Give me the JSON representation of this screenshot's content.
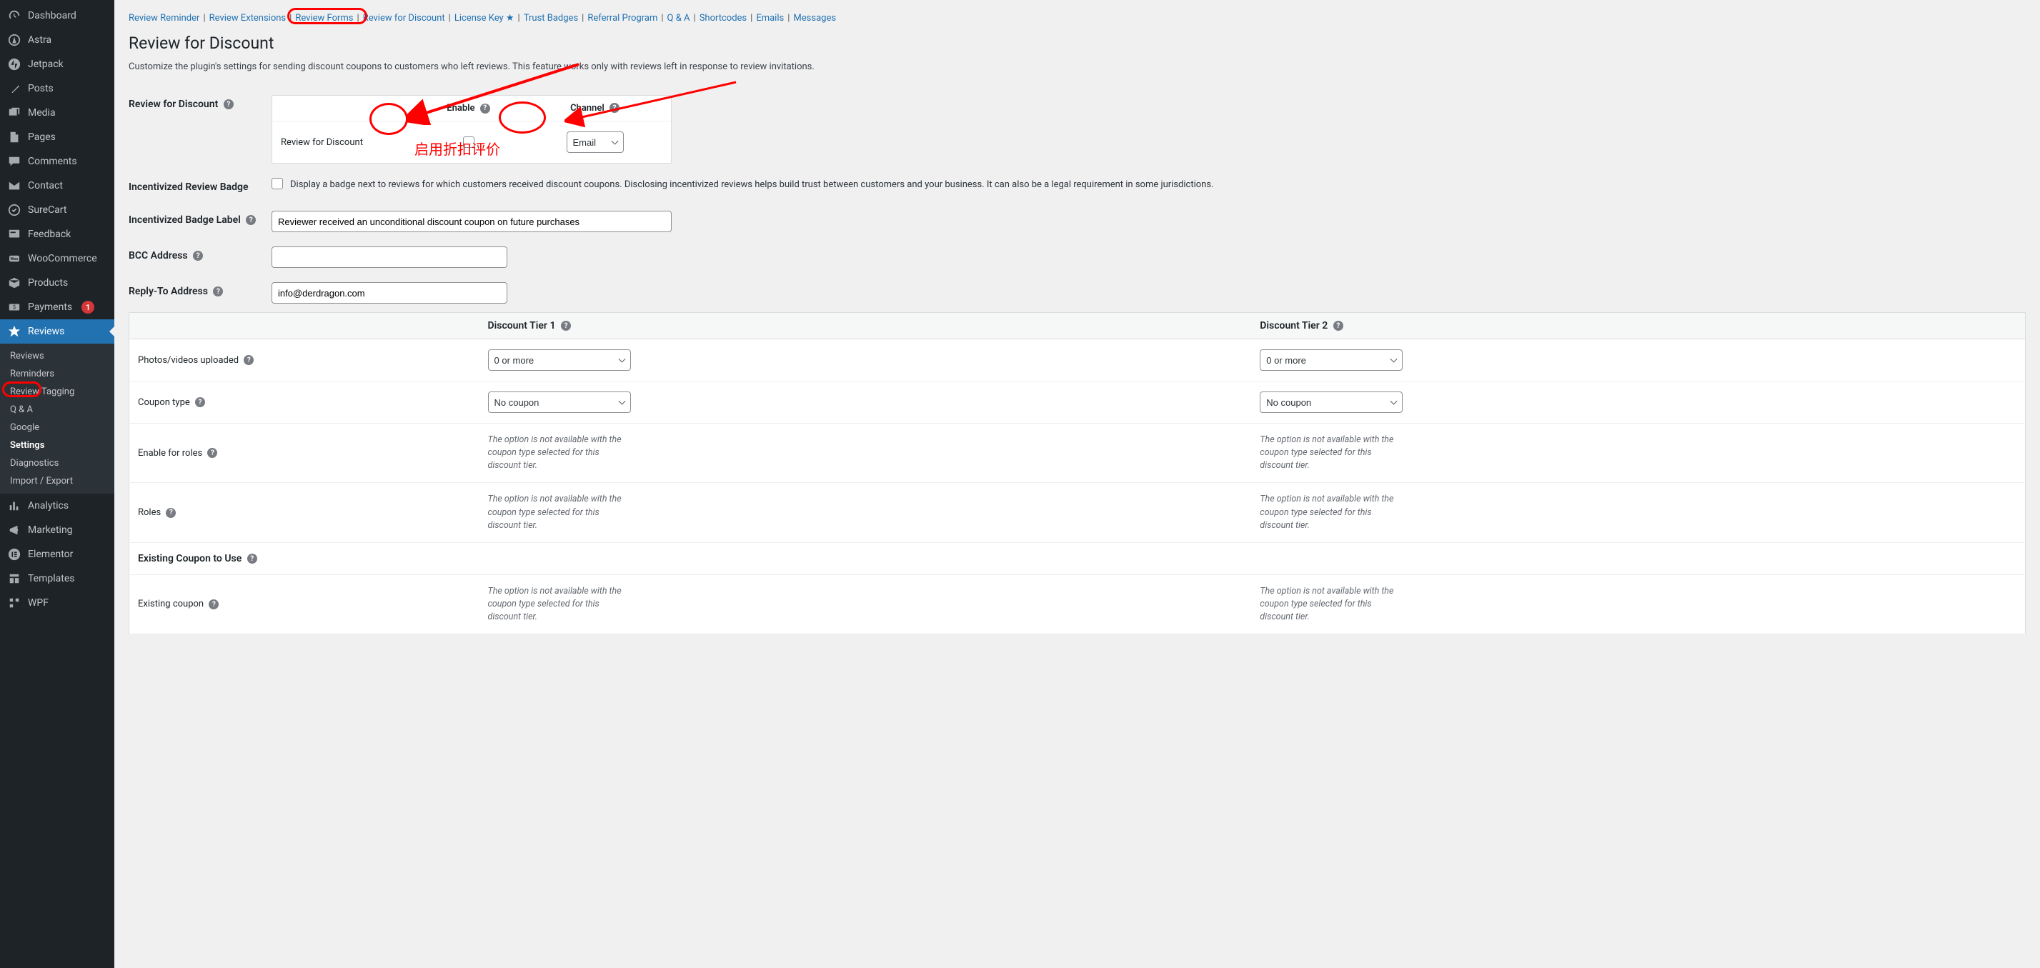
{
  "sidebar": {
    "items": [
      {
        "icon": "dashboard",
        "label": "Dashboard"
      },
      {
        "icon": "astra",
        "label": "Astra"
      },
      {
        "icon": "jetpack",
        "label": "Jetpack"
      },
      {
        "icon": "pin",
        "label": "Posts"
      },
      {
        "icon": "media",
        "label": "Media"
      },
      {
        "icon": "page",
        "label": "Pages"
      },
      {
        "icon": "comment",
        "label": "Comments"
      },
      {
        "icon": "envelope",
        "label": "Contact"
      },
      {
        "icon": "surecart",
        "label": "SureCart"
      },
      {
        "icon": "feedback",
        "label": "Feedback"
      },
      {
        "icon": "woo",
        "label": "WooCommerce"
      },
      {
        "icon": "box",
        "label": "Products"
      },
      {
        "icon": "payments",
        "label": "Payments",
        "badge": "1"
      },
      {
        "icon": "star",
        "label": "Reviews",
        "active": true
      }
    ],
    "submenu": [
      "Reviews",
      "Reminders",
      "Review Tagging",
      "Q & A",
      "Google",
      "Settings",
      "Diagnostics",
      "Import / Export"
    ],
    "submenu_selected": "Settings",
    "items_after": [
      {
        "icon": "analytics",
        "label": "Analytics"
      },
      {
        "icon": "marketing",
        "label": "Marketing"
      },
      {
        "icon": "elementor",
        "label": "Elementor"
      },
      {
        "icon": "templates",
        "label": "Templates"
      },
      {
        "icon": "wpe",
        "label": "WPF"
      }
    ]
  },
  "tabs": [
    "Review Reminder",
    "Review Extensions",
    "Review Forms",
    "Review for Discount",
    "License Key ★",
    "Trust Badges",
    "Referral Program",
    "Q & A",
    "Shortcodes",
    "Emails",
    "Messages"
  ],
  "page": {
    "title": "Review for Discount",
    "desc": "Customize the plugin's settings for sending discount coupons to customers who left reviews. This feature works only with reviews left in response to review invitations."
  },
  "fields": {
    "review_for_discount": {
      "th": "Review for Discount",
      "enable_hdr": "Enable",
      "channel_hdr": "Channel",
      "row_label": "Review for Discount",
      "channel_value": "Email"
    },
    "badge": {
      "th": "Incentivized Review Badge",
      "label": "Display a badge next to reviews for which customers received discount coupons. Disclosing incentivized reviews helps build trust between customers and your business. It can also be a legal requirement in some jurisdictions."
    },
    "badge_label": {
      "th": "Incentivized Badge Label",
      "value": "Reviewer received an unconditional discount coupon on future purchases"
    },
    "bcc": {
      "th": "BCC Address",
      "value": ""
    },
    "reply_to": {
      "th": "Reply-To Address",
      "value": "info@derdragon.com"
    }
  },
  "tiers": {
    "hdr1": "Discount Tier 1",
    "hdr2": "Discount Tier 2",
    "rows": [
      {
        "label": "Photos/videos uploaded",
        "v": "0 or more",
        "help": true,
        "type": "select"
      },
      {
        "label": "Coupon type",
        "v": "No coupon",
        "help": true,
        "type": "select"
      },
      {
        "label": "Enable for roles",
        "v": "__unavail",
        "help": true,
        "type": "text"
      },
      {
        "label": "Roles",
        "v": "__unavail",
        "help": true,
        "type": "text"
      }
    ],
    "section": "Existing Coupon to Use",
    "rows2": [
      {
        "label": "Existing coupon",
        "v": "__unavail",
        "help": true,
        "type": "text"
      }
    ],
    "unavail_text": "The option is not available with the coupon type selected for this discount tier."
  },
  "annotation": {
    "chinese": "启用折扣评价"
  }
}
